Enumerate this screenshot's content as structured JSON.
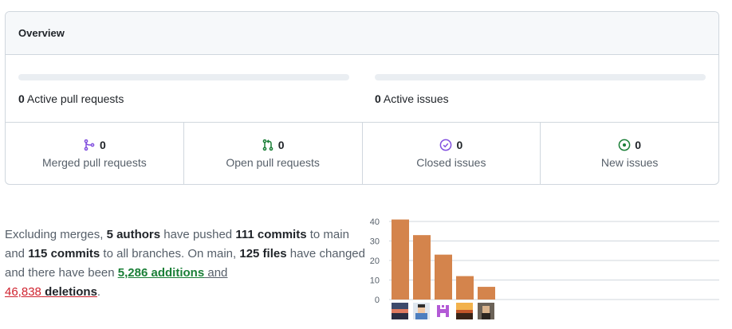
{
  "overview": {
    "title": "Overview",
    "active_pull_requests": {
      "count": "0",
      "label": "Active pull requests",
      "progress": 0
    },
    "active_issues": {
      "count": "0",
      "label": "Active issues",
      "progress": 0
    },
    "stats": [
      {
        "id": "merged",
        "icon": "git-merge-icon",
        "count": "0",
        "label": "Merged pull requests",
        "color": "#8250df"
      },
      {
        "id": "open",
        "icon": "git-pull-request-icon",
        "count": "0",
        "label": "Open pull requests",
        "color": "#1a7f37"
      },
      {
        "id": "closed",
        "icon": "issue-closed-icon",
        "count": "0",
        "label": "Closed issues",
        "color": "#8250df"
      },
      {
        "id": "new",
        "icon": "issue-opened-icon",
        "count": "0",
        "label": "New issues",
        "color": "#1a7f37"
      }
    ]
  },
  "summary": {
    "t1": "Excluding merges, ",
    "authors": "5 authors",
    "t2": " have pushed ",
    "commits_main": "111 commits",
    "t3": " to main and ",
    "commits_all": "115 commits",
    "t4": " to all branches. On main, ",
    "files": "125 files",
    "t5": " have changed and there have been ",
    "additions_num": "5,286",
    "additions_word": "additions",
    "t6": " and",
    "deletions_num": "46,838",
    "deletions_word": "deletions",
    "t7": "."
  },
  "chart_data": {
    "type": "bar",
    "values": [
      41,
      33,
      23,
      12,
      6.5
    ],
    "yticks": [
      "0",
      "10",
      "20",
      "30",
      "40"
    ],
    "ylim": [
      0,
      40
    ],
    "bar_color": "#d4844c",
    "grid": true,
    "avatar_icons": [
      "avatar-landscape-icon",
      "avatar-person-icon",
      "avatar-identicon-icon",
      "avatar-sunset-icon",
      "avatar-portrait-icon"
    ]
  }
}
